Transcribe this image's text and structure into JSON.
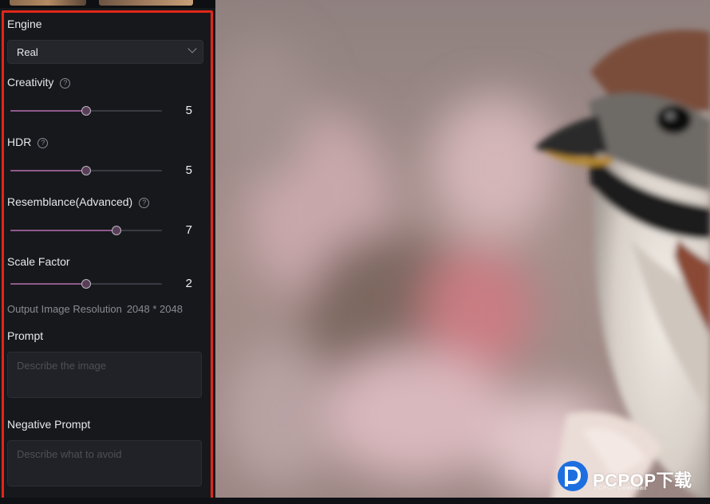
{
  "engine": {
    "label": "Engine",
    "value": "Real"
  },
  "sliders": [
    {
      "key": "creativity",
      "label": "Creativity",
      "help": true,
      "value": "5",
      "fill": 0.5
    },
    {
      "key": "hdr",
      "label": "HDR",
      "help": true,
      "value": "5",
      "fill": 0.5
    },
    {
      "key": "resemblance",
      "label": "Resemblance(Advanced)",
      "help": true,
      "value": "7",
      "fill": 0.7
    },
    {
      "key": "scale",
      "label": "Scale Factor",
      "help": false,
      "value": "2",
      "fill": 0.5
    }
  ],
  "output": {
    "label": "Output Image Resolution",
    "value": "2048 * 2048"
  },
  "prompt": {
    "label": "Prompt",
    "placeholder": "Describe the image"
  },
  "negative_prompt": {
    "label": "Negative Prompt",
    "placeholder": "Describe what to avoid"
  },
  "watermark": {
    "brand": "PCPOP下载",
    "sub": "PCPOP Download"
  },
  "colors": {
    "highlight_border": "#e0271a",
    "slider_fill": "#8e5a8c",
    "panel_bg": "#17181c",
    "watermark_logo": "#1d6fe0"
  }
}
